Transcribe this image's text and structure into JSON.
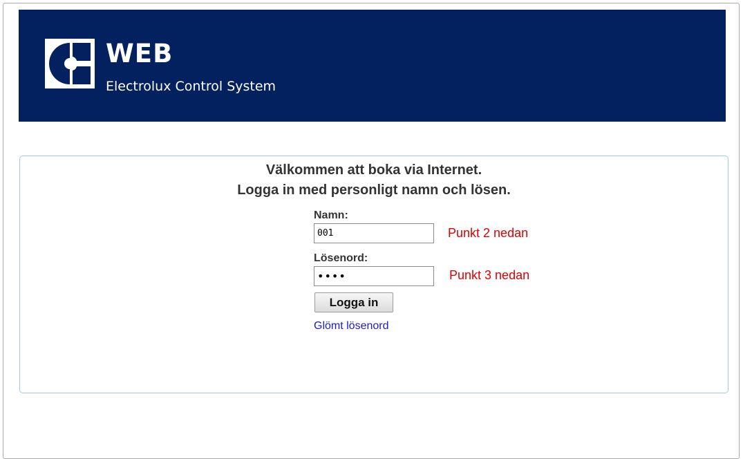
{
  "header": {
    "title": "WEB",
    "subtitle": "Electrolux Control System",
    "logo_icon": "electrolux-logo-icon",
    "background_color": "#04215f"
  },
  "login": {
    "welcome_line1": "Välkommen att boka via Internet.",
    "welcome_line2": "Logga in med personligt namn och lösen.",
    "name_label": "Namn:",
    "name_value": "001",
    "name_hint": "Punkt 2 nedan",
    "password_label": "Lösenord:",
    "password_value": "1234",
    "password_hint": "Punkt 3 nedan",
    "login_button": "Logga in",
    "forgot_link": "Glömt lösenord",
    "hint_color": "#e00000",
    "link_color": "#1a1ad6",
    "panel_border_color": "#9ec8ee"
  }
}
